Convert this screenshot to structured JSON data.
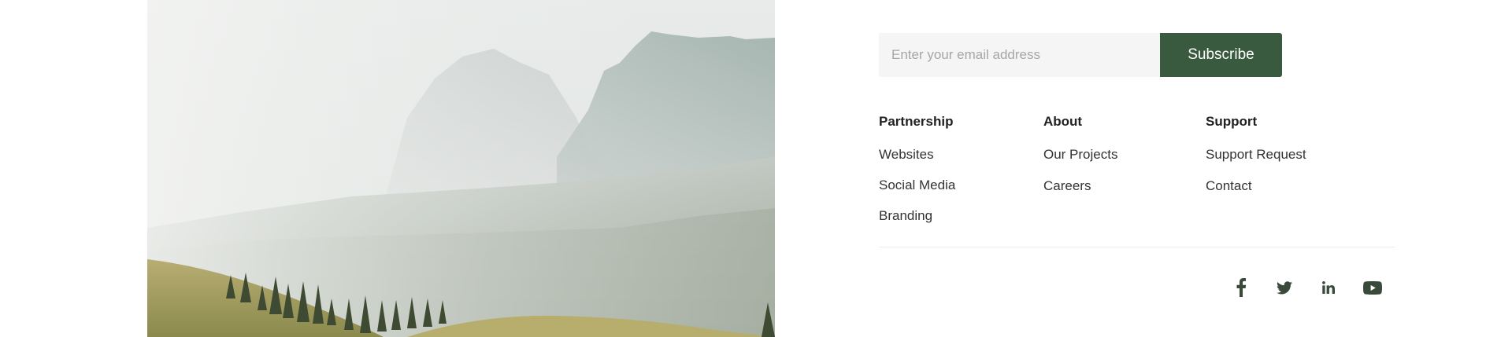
{
  "hero": {
    "image_description_icon": "mountain-landscape-image"
  },
  "newsletter": {
    "placeholder": "Enter your email address",
    "button_label": "Subscribe",
    "button_color": "#3a5a40"
  },
  "columns": {
    "partnership": {
      "title": "Partnership",
      "links": [
        "Websites",
        "Social Media",
        "Branding"
      ]
    },
    "about": {
      "title": "About",
      "links": [
        "Our Projects",
        "Careers"
      ]
    },
    "support": {
      "title": "Support",
      "links": [
        "Support Request",
        "Contact"
      ]
    }
  },
  "social": {
    "icons": [
      "facebook-icon",
      "twitter-icon",
      "linkedin-icon",
      "youtube-icon"
    ],
    "icon_color": "#3a4a3a"
  }
}
